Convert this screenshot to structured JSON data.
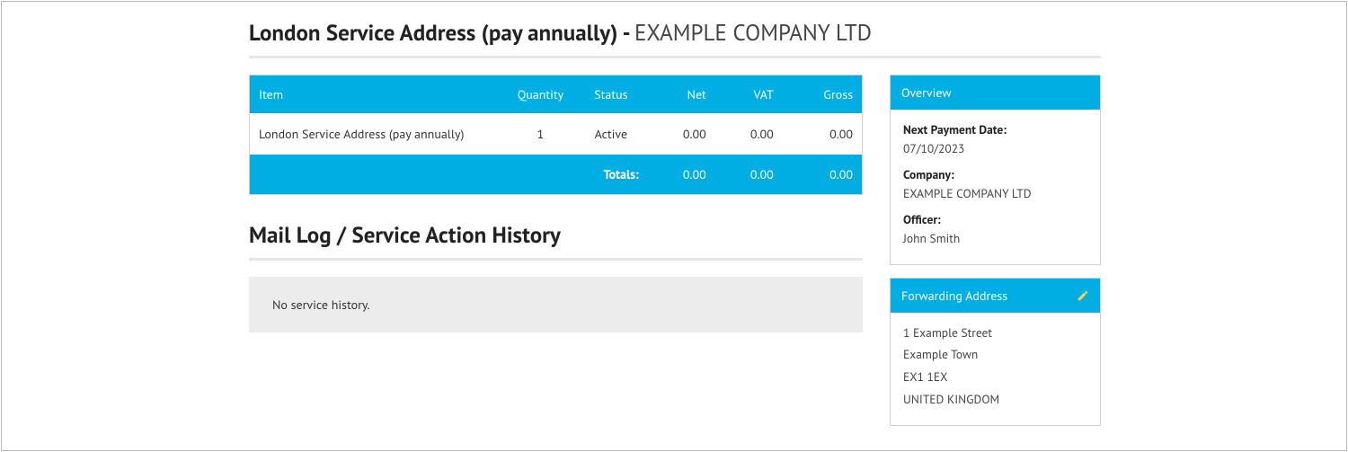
{
  "title": {
    "product": "London Service Address (pay annually)",
    "separator": " - ",
    "company": "EXAMPLE COMPANY LTD"
  },
  "items_table": {
    "headers": {
      "item": "Item",
      "quantity": "Quantity",
      "status": "Status",
      "net": "Net",
      "vat": "VAT",
      "gross": "Gross"
    },
    "row": {
      "item": "London Service Address (pay annually)",
      "quantity": "1",
      "status": "Active",
      "net": "0.00",
      "vat": "0.00",
      "gross": "0.00"
    },
    "totals_label": "Totals:",
    "totals": {
      "net": "0.00",
      "vat": "0.00",
      "gross": "0.00"
    }
  },
  "history": {
    "heading": "Mail Log / Service Action History",
    "empty": "No service history."
  },
  "overview": {
    "heading": "Overview",
    "next_payment_label": "Next Payment Date:",
    "next_payment_value": "07/10/2023",
    "company_label": "Company:",
    "company_value": "EXAMPLE COMPANY LTD",
    "officer_label": "Officer:",
    "officer_value": "John Smith"
  },
  "forwarding": {
    "heading": "Forwarding Address",
    "line1": "1 Example Street",
    "line2": "Example Town",
    "line3": "EX1 1EX",
    "line4": "UNITED KINGDOM"
  }
}
